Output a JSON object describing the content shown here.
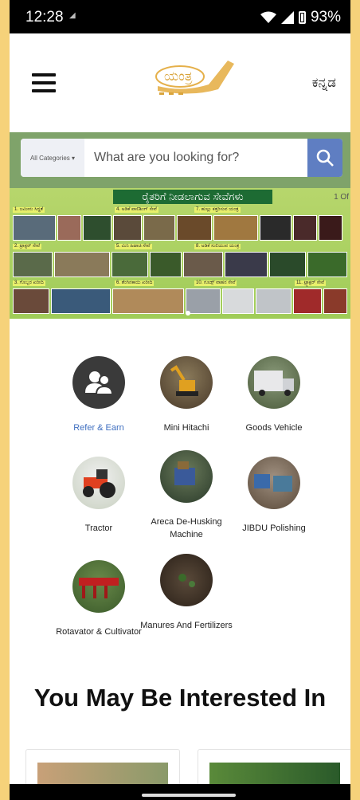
{
  "status_bar": {
    "time": "12:28",
    "battery": "93%"
  },
  "header": {
    "logo_text": "ಯಂತ್ರ",
    "language": "ಕನ್ನಡ"
  },
  "search": {
    "category_label": "All Categories ▾",
    "placeholder": "What are you looking for?"
  },
  "banner": {
    "title": "ರೈತರಿಗೆ ನೀಡಲಾಗುವ ಸೇವೆಗಳು",
    "page": "1 Of",
    "captions": [
      "1. ಜಮೀನು ಸಿದ್ಧತೆ",
      "4. ಅಡಿಕೆ ಪಾಲಿಶಿಂಗ್ ಸೇವೆ",
      "7. ಹುಲ್ಲು ಕತ್ತರಿಸುವ ಯಂತ್ರ",
      "2. ಟ್ರಾಕ್ಟರ್ ಸೇವೆ",
      "5. ಮಿನಿ ಹಿಟಾಚಿ ಸೇವೆ",
      "8. ಅಡಿಕೆ ಸುಲಿಯುವ ಯಂತ್ರ",
      "3. ಗೊಬ್ಬರ ಖರೀದಿ",
      "6. ತೆಂಗಿನಕಾಯಿ ಖರೀದಿ",
      "10. ಗೂಡ್ಸ್ ವಾಹನ ಸೇವೆ",
      "11. ಟ್ರ್ಯಾಕ್ಟರ್ ಸೇವೆ"
    ]
  },
  "services": [
    {
      "label": "Refer & Earn",
      "icon": "refer-earn-icon"
    },
    {
      "label": "Mini Hitachi",
      "icon": "mini-hitachi-image"
    },
    {
      "label": "Goods Vehicle",
      "icon": "goods-vehicle-image"
    },
    {
      "label": "Tractor",
      "icon": "tractor-image"
    },
    {
      "label": "Areca De-Husking Machine",
      "icon": "areca-machine-image"
    },
    {
      "label": "JIBDU Polishing",
      "icon": "jibdu-polishing-image"
    },
    {
      "label": "Rotavator & Cultivator",
      "icon": "rotavator-image"
    },
    {
      "label": "Manures And Fertilizers",
      "icon": "manure-image"
    }
  ],
  "section": {
    "heading": "You May Be Interested In"
  },
  "colors": {
    "accent": "#5f7ec2",
    "banner_green": "#9fcc58",
    "link_blue": "#3f6fc0"
  }
}
